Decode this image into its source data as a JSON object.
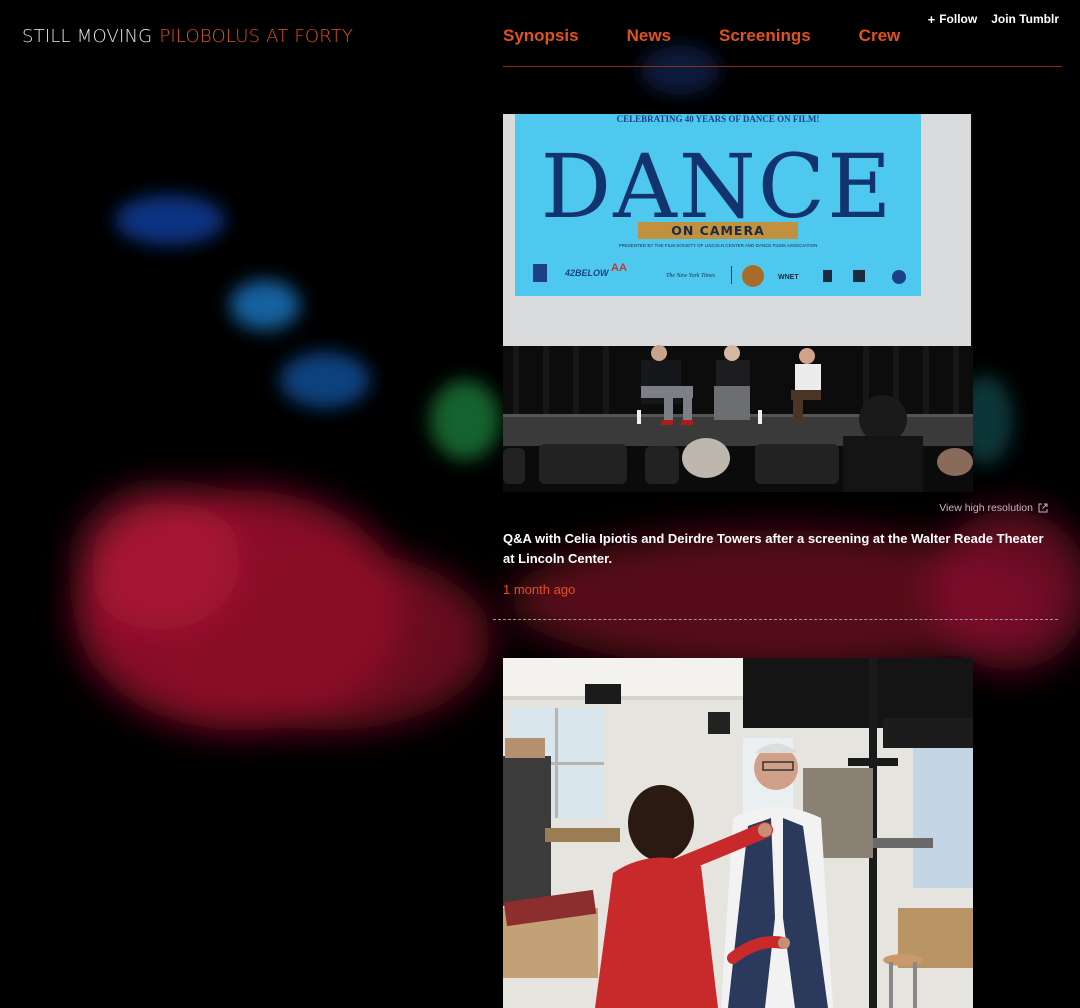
{
  "header": {
    "title_part1": "STILL MOVING",
    "title_part2": "PILOBOLUS AT FORTY"
  },
  "tumblr": {
    "follow_label": "Follow",
    "join_label": "Join Tumblr"
  },
  "nav": {
    "items": [
      "Synopsis",
      "News",
      "Screenings",
      "Crew"
    ]
  },
  "post1": {
    "screen": {
      "tagline": "CELEBRATING 40 YEARS OF DANCE ON FILM!",
      "big_word": "DANCE",
      "banner": "ON CAMERA",
      "sub": "PRESENTED BY THE FILM SOCIETY OF LINCOLN CENTER AND DANCE FILMS ASSOCIATION",
      "sponsor1": "42BELOW",
      "sponsor2": "The New York Times",
      "sponsor3": "WNET"
    },
    "view_hires_label": "View high resolution",
    "caption": "Q&A with Celia Ipiotis and Deirdre Towers after a screening at the Walter Reade Theater at Lincoln Center.",
    "timestamp": "1 month ago"
  },
  "colors": {
    "accent": "#e2511e",
    "background": "#000000"
  }
}
